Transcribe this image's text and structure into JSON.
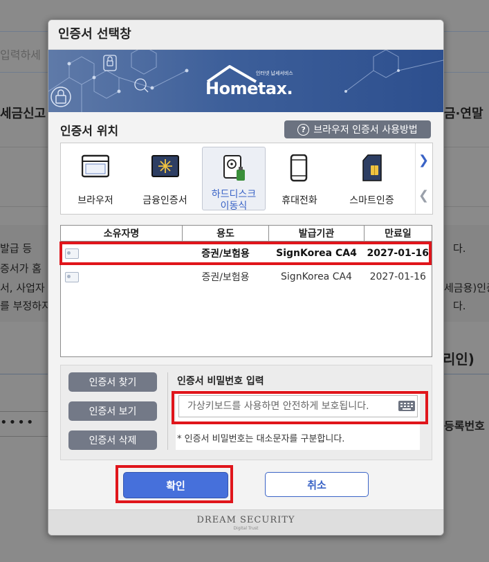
{
  "background": {
    "search_placeholder": "입력하세",
    "left_fragments": [
      "세금신고",
      "발급 등",
      "증서가 홈",
      "서, 사업자",
      "를 부정하지"
    ],
    "right_fragments": [
      "금·연말",
      "다.",
      "세금용)인증",
      "다.",
      "리인)",
      "등록번호"
    ],
    "masked_value": "••••"
  },
  "modal": {
    "title": "인증서 선택창",
    "banner": {
      "logo_text": "Hometax.",
      "logo_sub": "인터넷 납세서비스"
    },
    "location_label": "인증서 위치",
    "help_button": "브라우저 인증서 사용방법",
    "locations": [
      {
        "label": "브라우저",
        "icon": "browser-window-icon"
      },
      {
        "label": "금융인증서",
        "icon": "financial-cert-icon"
      },
      {
        "label": "하드디스크 이동식",
        "icon": "hard-disk-usb-icon",
        "active": true
      },
      {
        "label": "휴대전화",
        "icon": "mobile-phone-icon"
      },
      {
        "label": "스마트인증",
        "icon": "smart-cert-sim-icon"
      }
    ],
    "table": {
      "headers": [
        "소유자명",
        "용도",
        "발급기관",
        "만료일"
      ],
      "rows": [
        {
          "owner": "",
          "usage": "증권/보험용",
          "issuer": "SignKorea CA4",
          "expires": "2027-01-16",
          "selected": true
        },
        {
          "owner": "",
          "usage": "증권/보험용",
          "issuer": "SignKorea CA4",
          "expires": "2027-01-16",
          "selected": false
        }
      ]
    },
    "side_buttons": {
      "find": "인증서 찾기",
      "view": "인증서 보기",
      "delete": "인증서 삭제"
    },
    "password": {
      "label": "인증서 비밀번호 입력",
      "placeholder": "가상키보드를 사용하면 안전하게 보호됩니다.",
      "hint": "* 인증서 비밀번호는 대소문자를 구분합니다."
    },
    "ok_button": "확인",
    "cancel_button": "취소",
    "footer": {
      "brand": "DREAM SECURITY",
      "tagline": "Digital Trust"
    }
  },
  "colors": {
    "accent": "#4670db",
    "highlight": "#e0151b",
    "banner": "#3d5f9a"
  }
}
